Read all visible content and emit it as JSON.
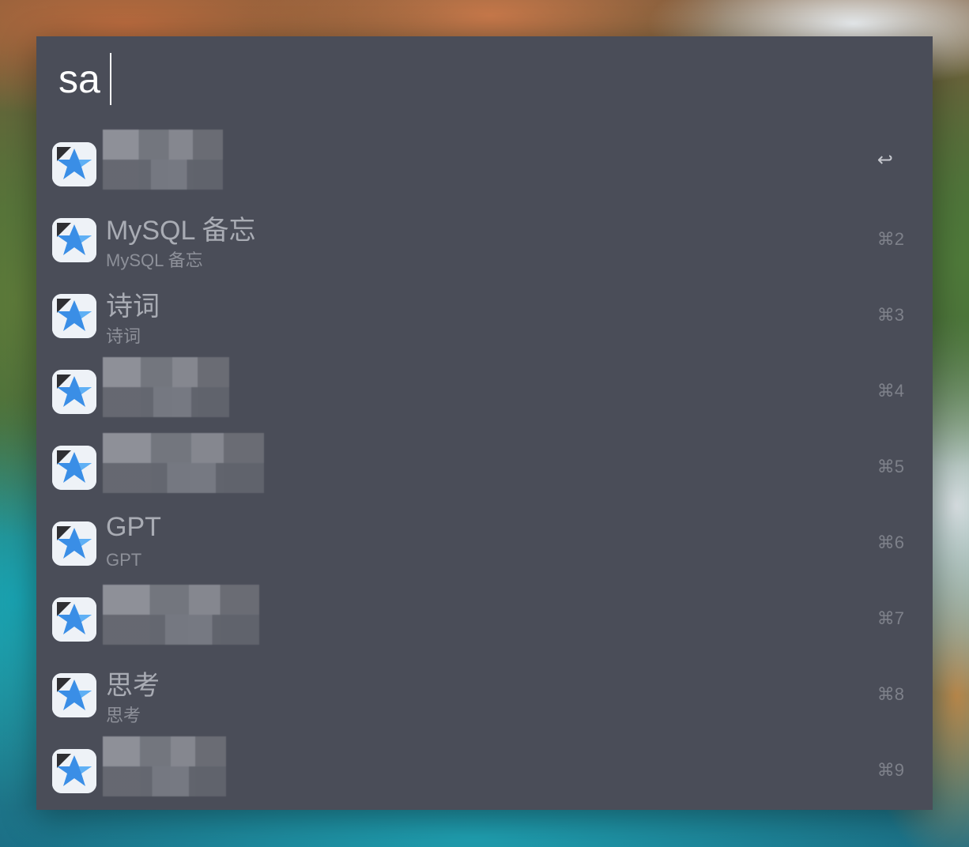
{
  "search": {
    "query": "sa"
  },
  "results": [
    {
      "title": "",
      "subtitle": "",
      "shortcut": "↩",
      "redacted": true
    },
    {
      "title": "MySQL 备忘",
      "subtitle": "MySQL 备忘",
      "shortcut": "⌘2",
      "redacted": false
    },
    {
      "title": "诗词",
      "subtitle": "诗词",
      "shortcut": "⌘3",
      "redacted": false
    },
    {
      "title": "",
      "subtitle": "",
      "shortcut": "⌘4",
      "redacted": true
    },
    {
      "title": "",
      "subtitle": "",
      "shortcut": "⌘5",
      "redacted": true
    },
    {
      "title": "GPT",
      "subtitle": "GPT",
      "shortcut": "⌘6",
      "redacted": false
    },
    {
      "title": "",
      "subtitle": "",
      "shortcut": "⌘7",
      "redacted": true
    },
    {
      "title": "思考",
      "subtitle": "思考",
      "shortcut": "⌘8",
      "redacted": false
    },
    {
      "title": "",
      "subtitle": "",
      "shortcut": "⌘9",
      "redacted": true
    }
  ],
  "icon": {
    "name": "notes-app-icon"
  }
}
